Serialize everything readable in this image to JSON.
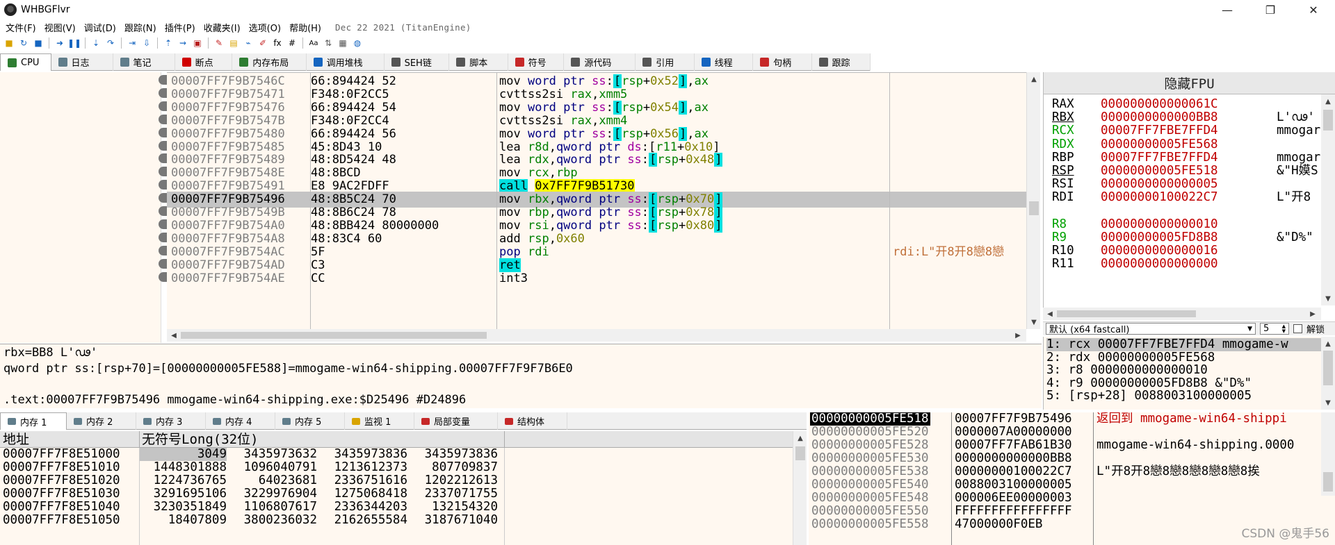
{
  "window": {
    "title": "WHBGFlvr",
    "minimize": "—",
    "maximize": "❐",
    "close": "✕"
  },
  "menu": [
    "文件(F)",
    "视图(V)",
    "调试(D)",
    "跟踪(N)",
    "插件(P)",
    "收藏夹(I)",
    "选项(O)",
    "帮助(H)"
  ],
  "build_date": "Dec 22 2021 (TitanEngine)",
  "tabs_main": [
    {
      "label": "CPU",
      "icon": "cpu-icon",
      "color": "#2e7d32"
    },
    {
      "label": "日志",
      "icon": "log-icon",
      "color": "#607d8b"
    },
    {
      "label": "笔记",
      "icon": "notes-icon",
      "color": "#607d8b"
    },
    {
      "label": "断点",
      "icon": "breakpoint-icon",
      "color": "#d00000"
    },
    {
      "label": "内存布局",
      "icon": "memory-map-icon",
      "color": "#2e7d32"
    },
    {
      "label": "调用堆栈",
      "icon": "call-stack-icon",
      "color": "#1565c0"
    },
    {
      "label": "SEH链",
      "icon": "seh-icon",
      "color": "#555555"
    },
    {
      "label": "脚本",
      "icon": "script-icon",
      "color": "#555555"
    },
    {
      "label": "符号",
      "icon": "symbol-icon",
      "color": "#c62828"
    },
    {
      "label": "源代码",
      "icon": "source-icon",
      "color": "#555555"
    },
    {
      "label": "引用",
      "icon": "references-icon",
      "color": "#555555"
    },
    {
      "label": "线程",
      "icon": "threads-icon",
      "color": "#1565c0"
    },
    {
      "label": "句柄",
      "icon": "handles-icon",
      "color": "#c62828"
    },
    {
      "label": "跟踪",
      "icon": "trace-icon",
      "color": "#555555"
    }
  ],
  "disasm": [
    {
      "addr": "00007FF7F9B7546C",
      "bytes": "66:894424 52",
      "instr": "mov word ptr ss:[rsp+0x52],ax",
      "cmt": ""
    },
    {
      "addr": "00007FF7F9B75471",
      "bytes": "F348:0F2CC5",
      "instr": "cvttss2si rax,xmm5",
      "cmt": ""
    },
    {
      "addr": "00007FF7F9B75476",
      "bytes": "66:894424 54",
      "instr": "mov word ptr ss:[rsp+0x54],ax",
      "cmt": ""
    },
    {
      "addr": "00007FF7F9B7547B",
      "bytes": "F348:0F2CC4",
      "instr": "cvttss2si rax,xmm4",
      "cmt": ""
    },
    {
      "addr": "00007FF7F9B75480",
      "bytes": "66:894424 56",
      "instr": "mov word ptr ss:[rsp+0x56],ax",
      "cmt": ""
    },
    {
      "addr": "00007FF7F9B75485",
      "bytes": "45:8D43 10",
      "instr": "lea r8d,qword ptr ds:[r11+0x10]",
      "cmt": ""
    },
    {
      "addr": "00007FF7F9B75489",
      "bytes": "48:8D5424 48",
      "instr": "lea rdx,qword ptr ss:[rsp+0x48]",
      "cmt": ""
    },
    {
      "addr": "00007FF7F9B7548E",
      "bytes": "48:8BCD",
      "instr": "mov rcx,rbp",
      "cmt": ""
    },
    {
      "addr": "00007FF7F9B75491",
      "bytes": "E8 9AC2FDFF",
      "instr": "call 0x7FF7F9B51730",
      "cmt": ""
    },
    {
      "addr": "00007FF7F9B75496",
      "bytes": "48:8B5C24 70",
      "instr": "mov rbx,qword ptr ss:[rsp+0x70]",
      "cmt": ""
    },
    {
      "addr": "00007FF7F9B7549B",
      "bytes": "48:8B6C24 78",
      "instr": "mov rbp,qword ptr ss:[rsp+0x78]",
      "cmt": ""
    },
    {
      "addr": "00007FF7F9B754A0",
      "bytes": "48:8BB424 80000000",
      "instr": "mov rsi,qword ptr ss:[rsp+0x80]",
      "cmt": ""
    },
    {
      "addr": "00007FF7F9B754A8",
      "bytes": "48:83C4 60",
      "instr": "add rsp,0x60",
      "cmt": ""
    },
    {
      "addr": "00007FF7F9B754AC",
      "bytes": "5F",
      "instr": "pop rdi",
      "cmt": "rdi:L\"开8开8戀8戀"
    },
    {
      "addr": "00007FF7F9B754AD",
      "bytes": "C3",
      "instr": "ret",
      "cmt": ""
    },
    {
      "addr": "00007FF7F9B754AE",
      "bytes": "CC",
      "instr": "int3",
      "cmt": ""
    }
  ],
  "info": {
    "line1": "rbx=BB8 L'ഢ'",
    "line2": "qword ptr ss:[rsp+70]=[00000000005FE588]=mmogame-win64-shipping.00007FF7F9F7B6E0",
    "line3": "",
    "line4": ".text:00007FF7F9B75496 mmogame-win64-shipping.exe:$D25496 #D24896"
  },
  "registers": {
    "header": "隐藏FPU",
    "rows": [
      {
        "name": "RAX",
        "val": "000000000000061C",
        "info": "",
        "green": false,
        "ul": false
      },
      {
        "name": "RBX",
        "val": "0000000000000BB8",
        "info": "L'ഢ'",
        "green": false,
        "ul": true
      },
      {
        "name": "RCX",
        "val": "00007FF7FBE7FFD4",
        "info": "mmogar",
        "green": true,
        "ul": false
      },
      {
        "name": "RDX",
        "val": "00000000005FE568",
        "info": "",
        "green": true,
        "ul": false
      },
      {
        "name": "RBP",
        "val": "00007FF7FBE7FFD4",
        "info": "mmogar",
        "green": false,
        "ul": false
      },
      {
        "name": "RSP",
        "val": "00000000005FE518",
        "info": "&\"H嫫S",
        "green": false,
        "ul": true
      },
      {
        "name": "RSI",
        "val": "0000000000000005",
        "info": "",
        "green": false,
        "ul": false
      },
      {
        "name": "RDI",
        "val": "00000000100022C7",
        "info": "L\"开8",
        "green": false,
        "ul": false
      },
      {
        "name": "R8",
        "val": "0000000000000010",
        "info": "",
        "green": true,
        "ul": false
      },
      {
        "name": "R9",
        "val": "00000000005FD8B8",
        "info": "&\"D%\"",
        "green": true,
        "ul": false
      },
      {
        "name": "R10",
        "val": "0000000000000016",
        "info": "",
        "green": false,
        "ul": false
      },
      {
        "name": "R11",
        "val": "0000000000000000",
        "info": "",
        "green": false,
        "ul": false
      }
    ]
  },
  "callconv": {
    "selected": "默认 (x64 fastcall)",
    "count": "5",
    "unlock_label": "解锁"
  },
  "args": [
    "1: rcx 00007FF7FBE7FFD4 mmogame-w",
    "2: rdx 00000000005FE568",
    "3: r8 0000000000000010",
    "4: r9 00000000005FD8B8 &\"D%\"",
    "5: [rsp+28] 0088003100000005"
  ],
  "tabs_dump": [
    {
      "label": "内存 1",
      "icon": "dump-icon"
    },
    {
      "label": "内存 2",
      "icon": "dump-icon"
    },
    {
      "label": "内存 3",
      "icon": "dump-icon"
    },
    {
      "label": "内存 4",
      "icon": "dump-icon"
    },
    {
      "label": "内存 5",
      "icon": "dump-icon"
    },
    {
      "label": "监视 1",
      "icon": "watch-icon"
    },
    {
      "label": "局部变量",
      "icon": "locals-icon"
    },
    {
      "label": "结构体",
      "icon": "struct-icon"
    }
  ],
  "dump": {
    "col_addr": "地址",
    "col_data": "无符号Long(32位)",
    "rows": [
      {
        "addr": "00007FF7F8E51000",
        "v": [
          "3049",
          "3435973632",
          "3435973836",
          "3435973836"
        ]
      },
      {
        "addr": "00007FF7F8E51010",
        "v": [
          "1448301888",
          "1096040791",
          "1213612373",
          "807709837"
        ]
      },
      {
        "addr": "00007FF7F8E51020",
        "v": [
          "1224736765",
          "64023681",
          "2336751616",
          "1202212613"
        ]
      },
      {
        "addr": "00007FF7F8E51030",
        "v": [
          "3291695106",
          "3229976904",
          "1275068418",
          "2337071755"
        ]
      },
      {
        "addr": "00007FF7F8E51040",
        "v": [
          "3230351849",
          "1106807617",
          "2336344203",
          "132154320"
        ]
      },
      {
        "addr": "00007FF7F8E51050",
        "v": [
          "18407809",
          "3800236032",
          "2162655584",
          "3187671040"
        ]
      }
    ]
  },
  "stack": [
    {
      "addr": "00000000005FE518",
      "val": "00007FF7F9B75496",
      "cmt": "返回到 mmogame-win64-shippi",
      "red": true,
      "cur": true
    },
    {
      "addr": "00000000005FE520",
      "val": "0000007A00000000",
      "cmt": "",
      "red": false,
      "cur": false
    },
    {
      "addr": "00000000005FE528",
      "val": "00007FF7FAB61B30",
      "cmt": "mmogame-win64-shipping.0000",
      "red": false,
      "cur": false
    },
    {
      "addr": "00000000005FE530",
      "val": "0000000000000BB8",
      "cmt": "",
      "red": false,
      "cur": false
    },
    {
      "addr": "00000000005FE538",
      "val": "00000000100022C7",
      "cmt": "L\"开8开8戀8戀8戀8戀8戀8挨",
      "red": false,
      "cur": false
    },
    {
      "addr": "00000000005FE540",
      "val": "0088003100000005",
      "cmt": "",
      "red": false,
      "cur": false
    },
    {
      "addr": "00000000005FE548",
      "val": "000006EE00000003",
      "cmt": "",
      "red": false,
      "cur": false
    },
    {
      "addr": "00000000005FE550",
      "val": "FFFFFFFFFFFFFFFF",
      "cmt": "",
      "red": false,
      "cur": false
    },
    {
      "addr": "00000000005FE558",
      "val": "47000000F0EB",
      "cmt": "",
      "red": false,
      "cur": false
    }
  ],
  "watermark": "CSDN @鬼手56"
}
